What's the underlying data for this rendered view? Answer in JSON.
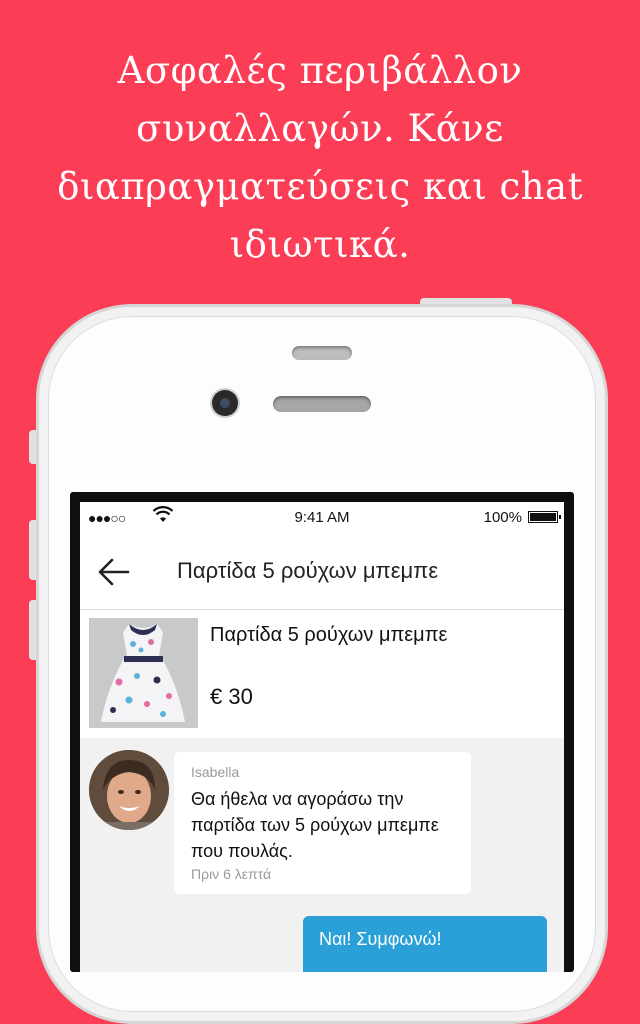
{
  "headline": {
    "line1": "Ασφαλές περιβάλλον",
    "line2": "συναλλαγών. Κάνε",
    "line3": "διαπραγματεύσεις και chat",
    "line4": "ιδιωτικά."
  },
  "statusbar": {
    "signal": "●●●○○",
    "time": "9:41 AM",
    "battery_percent": "100%",
    "battery_level": 1.0
  },
  "navbar": {
    "back_icon": "arrow-left-icon",
    "title": "Παρτίδα 5 ρούχων μπεμπε"
  },
  "product": {
    "title": "Παρτίδα 5 ρούχων μπεμπε",
    "price": "€ 30"
  },
  "chat": {
    "incoming": {
      "sender": "Isabella",
      "message": "Θα ήθελα να αγοράσω την παρτίδα των 5 ρούχων μπεμπε που πουλάς.",
      "time": "Πριν 6 λεπτά"
    },
    "outgoing": {
      "message": "Ναι! Συμφωνώ!"
    }
  },
  "colors": {
    "background": "#fb3d55",
    "outgoing_bubble": "#2a9fd8"
  }
}
